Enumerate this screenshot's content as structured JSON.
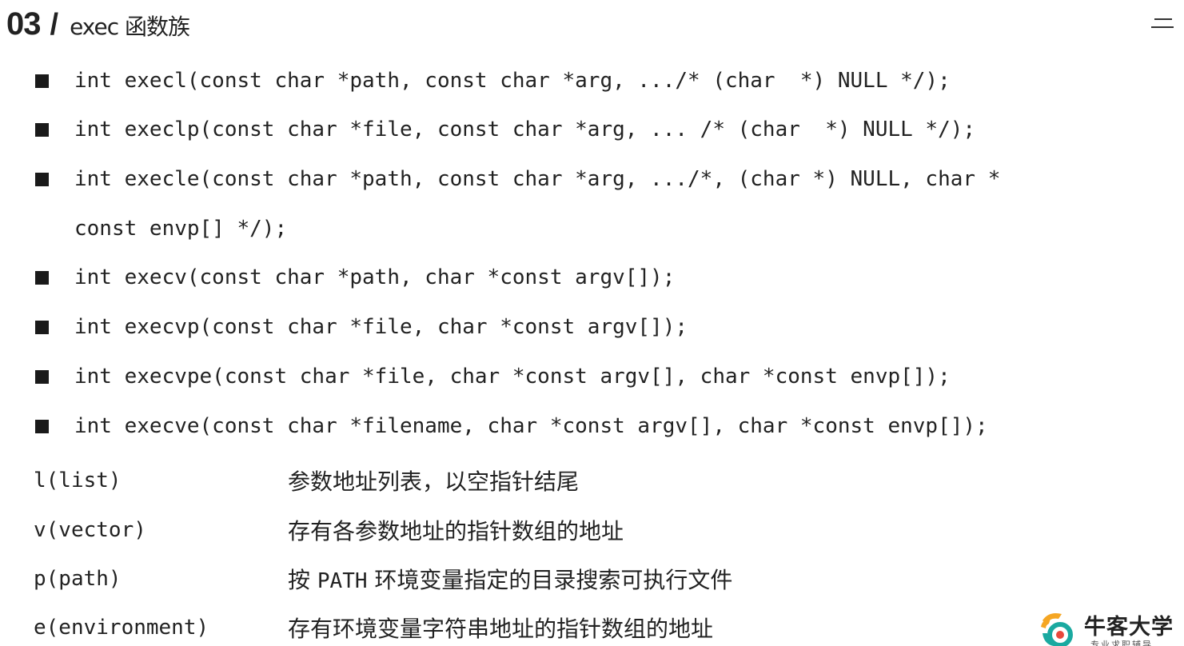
{
  "header": {
    "number": "03",
    "slash": "/",
    "title": "exec 函数族"
  },
  "functions": [
    "int execl(const char *path, const char *arg, .../* (char  *) NULL */);",
    "int execlp(const char *file, const char *arg, ... /* (char  *) NULL */);",
    "int execle(const char *path, const char *arg, .../*, (char *) NULL, char *",
    "const envp[] */);",
    "int execv(const char *path, char *const argv[]);",
    "int execvp(const char *file, char *const argv[]);",
    "int execvpe(const char *file, char *const argv[], char *const envp[]);",
    "int execve(const char *filename, char *const argv[], char *const envp[]);"
  ],
  "legend": [
    {
      "key": "l(list)",
      "desc": "参数地址列表，以空指针结尾"
    },
    {
      "key": "v(vector)",
      "desc": "存有各参数地址的指针数组的地址"
    },
    {
      "key": "p(path)",
      "desc_before": "按 ",
      "desc_code": "PATH",
      "desc_after": " 环境变量指定的目录搜索可执行文件"
    },
    {
      "key": "e(environment)",
      "desc": "存有环境变量字符串地址的指针数组的地址"
    }
  ],
  "logo": {
    "name": "牛客大学",
    "tagline": "专业求职辅导"
  },
  "colors": {
    "text": "#222222",
    "logo_orange": "#f5a623",
    "logo_teal": "#1aa9a0"
  },
  "icons": {
    "menu": "menu-icon",
    "bullet": "square-bullet-icon",
    "logo": "niuke-logo-icon"
  }
}
